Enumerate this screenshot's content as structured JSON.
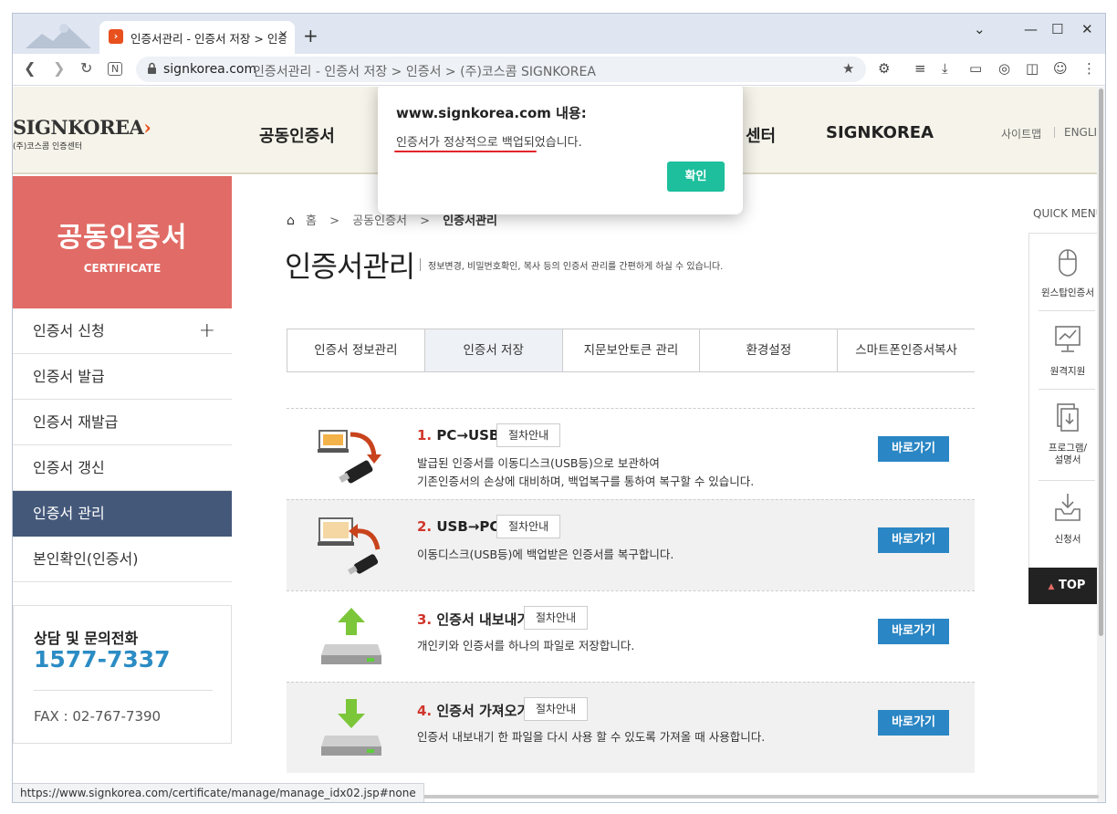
{
  "browser": {
    "tab_title": "인증서관리 - 인증서 저장 > 인증서 > (주)코스콤 SIGNKOREA",
    "new_tab_label": "+",
    "url_host": "signkorea.com",
    "url_path": "인증서관리 - 인증서 저장 > 인증서 > (주)코스콤 SIGNKOREA",
    "status_url": "https://www.signkorea.com/certificate/manage/manage_idx02.jsp#none"
  },
  "header": {
    "logo_text": "SIGNKOREA",
    "logo_sub": "(주)코스콤 인증센터",
    "nav": [
      "공동인증서",
      "센터",
      "SIGNKOREA"
    ],
    "util": [
      "사이트맵",
      "ENGLISH"
    ]
  },
  "sidebar": {
    "title": "공동인증서",
    "subtitle": "CERTIFICATE",
    "items": [
      {
        "label": "인증서 신청",
        "toggle": "+"
      },
      {
        "label": "인증서 발급"
      },
      {
        "label": "인증서 재발급"
      },
      {
        "label": "인증서 갱신"
      },
      {
        "label": "인증서 관리"
      },
      {
        "label": "본인확인(인증서)"
      }
    ],
    "contact": {
      "title": "상담 및 문의전화",
      "phone": "1577-7337",
      "fax": "FAX : 02-767-7390"
    }
  },
  "main": {
    "breadcrumb": {
      "home": "홈",
      "sep": ">",
      "level1": "공동인증서",
      "current": "인증서관리"
    },
    "title": "인증서관리",
    "description": "정보변경, 비밀번호확인, 복사 등의 인증서 관리를 간편하게 하실 수 있습니다.",
    "tabs": [
      "인증서 정보관리",
      "인증서 저장",
      "지문보안토큰 관리",
      "환경설정",
      "스마트폰인증서복사"
    ],
    "rows": [
      {
        "num": "1.",
        "title": "PC→USB",
        "guide": "절차안내",
        "desc1": "발급된 인증서를 이동디스크(USB등)으로 보관하여",
        "desc2": "기존인증서의 손상에 대비하며, 백업복구를 통하여 복구할 수 있습니다.",
        "button": "바로가기"
      },
      {
        "num": "2.",
        "title": "USB→PC",
        "guide": "절차안내",
        "desc1": "이동디스크(USB등)에 백업받은 인증서를 복구합니다.",
        "desc2": "",
        "button": "바로가기"
      },
      {
        "num": "3.",
        "title": "인증서 내보내기",
        "guide": "절차안내",
        "desc1": "개인키와 인증서를 하나의 파일로 저장합니다.",
        "desc2": "",
        "button": "바로가기"
      },
      {
        "num": "4.",
        "title": "인증서 가져오기",
        "guide": "절차안내",
        "desc1": "인증서 내보내기 한 파일을 다시 사용 할 수 있도록 가져올 때 사용합니다.",
        "desc2": "",
        "button": "바로가기"
      }
    ]
  },
  "quick_menu": {
    "title": "QUICK MENU",
    "items": [
      "윈스탑인증서",
      "원격지원",
      "프로그램/설명서",
      "신청서"
    ],
    "top_label": "TOP"
  },
  "dialog": {
    "title": "www.signkorea.com 내용:",
    "message": "인증서가 정상적으로 백업되었습니다.",
    "ok_label": "확인"
  },
  "colors": {
    "sidebar_header": "#e16b66",
    "sidebar_active": "#44587a",
    "phone": "#2b8cc4",
    "go_button": "#2a86c4",
    "dialog_ok": "#1dbf9c",
    "row_number": "#d0352c",
    "annotation_underline": "#e0262b"
  }
}
